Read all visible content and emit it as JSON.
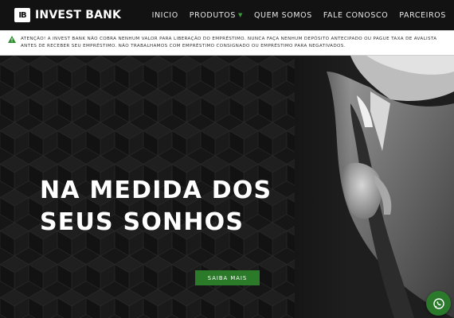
{
  "brand": {
    "logo_mark": "IB",
    "name": "INVEST BANK"
  },
  "nav": {
    "items": [
      {
        "label": "INICIO"
      },
      {
        "label": "PRODUTOS",
        "has_dropdown": true
      },
      {
        "label": "QUEM SOMOS"
      },
      {
        "label": "FALE CONOSCO"
      },
      {
        "label": "PARCEIROS"
      }
    ]
  },
  "alert": {
    "icon": "warning-icon",
    "text": "ATENÇÃO! A INVEST BANK NÃO COBRA NENHUM VALOR PARA LIBERAÇÃO DO EMPRÉSTIMO. NUNCA FAÇA NENHUM DEPÓSITO ANTECIPADO OU PAGUE TAXA DE AVALISTA ANTES DE RECEBER SEU EMPRÉSTIMO. NÃO TRABALHAMOS COM EMPRÉSTIMO CONSIGNADO OU EMPRÉSTIMO PARA NEGATIVADOS."
  },
  "hero": {
    "title_line1": "NA MEDIDA DOS",
    "title_line2": "SEUS SONHOS",
    "cta_label": "SAIBA MAIS"
  },
  "floating": {
    "icon": "whatsapp-icon"
  },
  "colors": {
    "accent": "#2a7a2a",
    "dark": "#121212",
    "warning": "#2f8f2f"
  }
}
